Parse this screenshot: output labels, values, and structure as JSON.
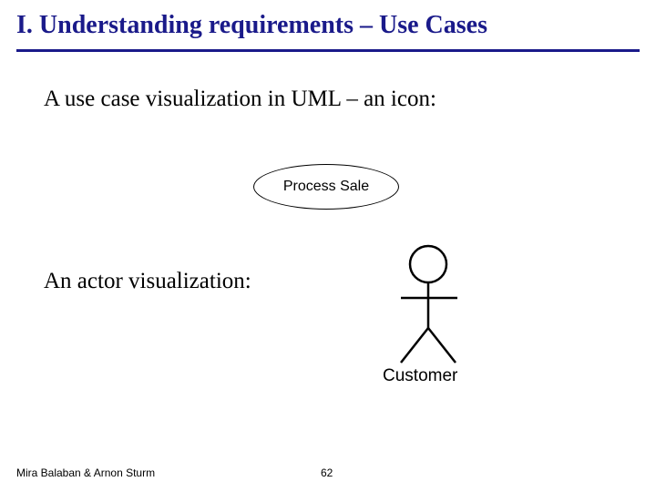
{
  "title": "I. Understanding requirements – Use Cases",
  "body": {
    "line1": "A use case visualization in UML – an icon:",
    "line2": "An actor visualization:"
  },
  "use_case": {
    "label": "Process Sale"
  },
  "actor": {
    "label": "Customer"
  },
  "footer": {
    "authors": "Mira Balaban  &  Arnon Sturm",
    "page": "62"
  }
}
